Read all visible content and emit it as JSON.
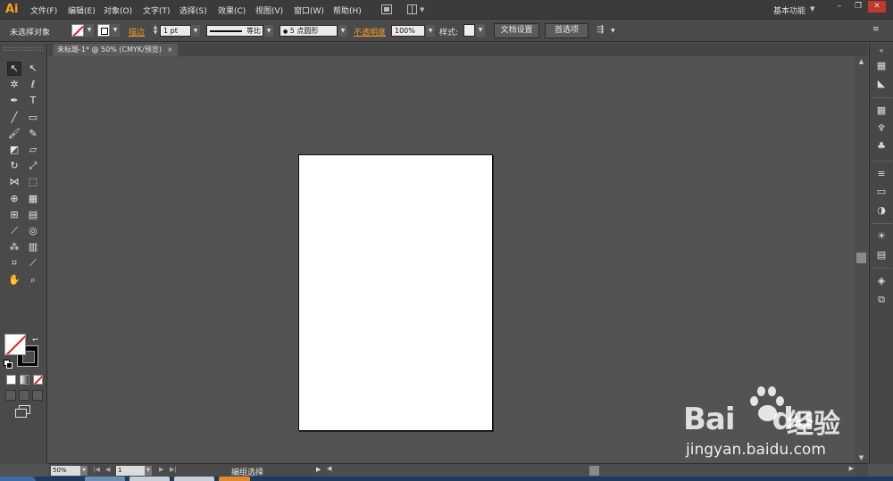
{
  "app": {
    "logo": "Ai",
    "menus": [
      "文件(F)",
      "编辑(E)",
      "对象(O)",
      "文字(T)",
      "选择(S)",
      "效果(C)",
      "视图(V)",
      "窗口(W)",
      "帮助(H)"
    ],
    "workspace": "基本功能",
    "window_controls": [
      "–",
      "❐",
      "✕"
    ]
  },
  "control_bar": {
    "selection_label": "未选择对象",
    "stroke_label": "描边",
    "stroke_weight": "1 pt",
    "profile_label": "等比",
    "brush_label": "5 点圆形",
    "opacity_label": "不透明度",
    "opacity_value": "100%",
    "style_label": "样式",
    "doc_setup_button": "文档设置",
    "preferences_button": "首选项",
    "colors": {
      "link_orange": "#f39a25",
      "none_red": "#e02020"
    }
  },
  "document": {
    "tab_title": "未标题-1* @ 50% (CMYK/预览)",
    "close": "×"
  },
  "tools": [
    {
      "name": "selection-tool-icon",
      "glyph": "↖",
      "active": true
    },
    {
      "name": "direct-selection-tool-icon",
      "glyph": "↖"
    },
    {
      "name": "magic-wand-tool-icon",
      "glyph": "✲"
    },
    {
      "name": "lasso-tool-icon",
      "glyph": "ℓ"
    },
    {
      "name": "pen-tool-icon",
      "glyph": "✒"
    },
    {
      "name": "type-tool-icon",
      "glyph": "T"
    },
    {
      "name": "line-tool-icon",
      "glyph": "╱"
    },
    {
      "name": "rectangle-tool-icon",
      "glyph": "▭"
    },
    {
      "name": "paintbrush-tool-icon",
      "glyph": "🖌"
    },
    {
      "name": "pencil-tool-icon",
      "glyph": "✎"
    },
    {
      "name": "blob-brush-tool-icon",
      "glyph": "◩"
    },
    {
      "name": "eraser-tool-icon",
      "glyph": "▱"
    },
    {
      "name": "rotate-tool-icon",
      "glyph": "↻"
    },
    {
      "name": "scale-tool-icon",
      "glyph": "⤢"
    },
    {
      "name": "width-tool-icon",
      "glyph": "⋈"
    },
    {
      "name": "free-transform-tool-icon",
      "glyph": "⬚"
    },
    {
      "name": "shape-builder-tool-icon",
      "glyph": "⊕"
    },
    {
      "name": "perspective-grid-tool-icon",
      "glyph": "▦"
    },
    {
      "name": "mesh-tool-icon",
      "glyph": "⊞"
    },
    {
      "name": "gradient-tool-icon",
      "glyph": "▤"
    },
    {
      "name": "eyedropper-tool-icon",
      "glyph": "⟋"
    },
    {
      "name": "blend-tool-icon",
      "glyph": "◎"
    },
    {
      "name": "symbol-sprayer-tool-icon",
      "glyph": "⁂"
    },
    {
      "name": "column-graph-tool-icon",
      "glyph": "▥"
    },
    {
      "name": "artboard-tool-icon",
      "glyph": "⌗"
    },
    {
      "name": "slice-tool-icon",
      "glyph": "⟋"
    },
    {
      "name": "hand-tool-icon",
      "glyph": "✋"
    },
    {
      "name": "zoom-tool-icon",
      "glyph": "⌕"
    }
  ],
  "right_dock": [
    {
      "name": "color-panel-icon",
      "glyph": "▦"
    },
    {
      "name": "color-guide-panel-icon",
      "glyph": "◣"
    },
    {
      "name": "swatches-panel-icon",
      "glyph": "▦"
    },
    {
      "name": "brushes-panel-icon",
      "glyph": "♆"
    },
    {
      "name": "symbols-panel-icon",
      "glyph": "♣"
    },
    {
      "name": "stroke-panel-icon",
      "glyph": "≡"
    },
    {
      "name": "gradient-panel-icon",
      "glyph": "▭"
    },
    {
      "name": "transparency-panel-icon",
      "glyph": "◑"
    },
    {
      "name": "appearance-panel-icon",
      "glyph": "☀"
    },
    {
      "name": "graphic-styles-panel-icon",
      "glyph": "▤"
    },
    {
      "name": "layers-panel-icon",
      "glyph": "◈"
    },
    {
      "name": "artboards-panel-icon",
      "glyph": "⧉"
    }
  ],
  "status_bar": {
    "zoom": "50%",
    "page": "1",
    "status_text": "编组选择"
  },
  "watermark": {
    "brand": "Bai",
    "brand2": "du",
    "chinese": "经验",
    "url": "jingyan.baidu.com"
  }
}
